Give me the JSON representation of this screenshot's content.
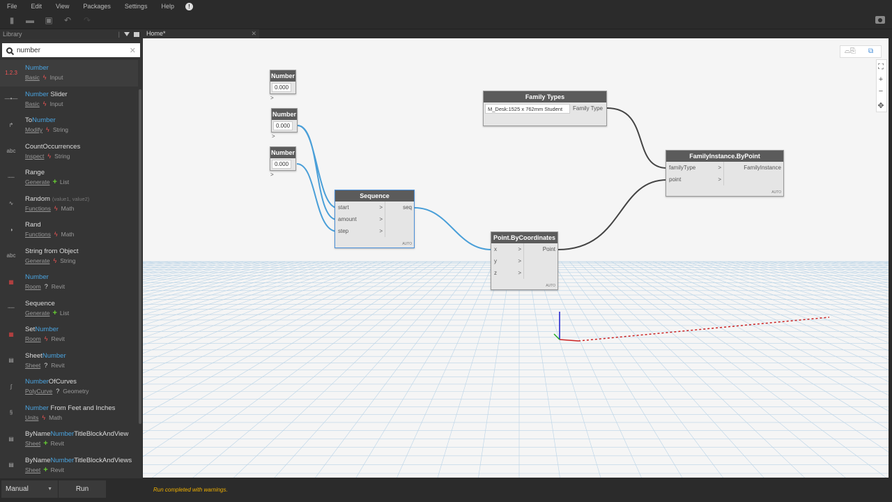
{
  "menu": [
    "File",
    "Edit",
    "View",
    "Packages",
    "Settings",
    "Help"
  ],
  "library": {
    "title": "Library",
    "search_value": "number",
    "items": [
      {
        "icon": "1.2.3",
        "pre": "",
        "hl": "Number",
        "post": "",
        "args": "",
        "cat": "Basic",
        "rel": "bolt",
        "grp": "Input",
        "sel": true
      },
      {
        "icon": "slider",
        "pre": "",
        "hl": "Number",
        "post": " Slider",
        "args": "",
        "cat": "Basic",
        "rel": "bolt",
        "grp": "Input"
      },
      {
        "icon": "to",
        "pre": "To",
        "hl": "Number",
        "post": "",
        "args": "",
        "cat": "Modify",
        "rel": "bolt",
        "grp": "String"
      },
      {
        "icon": "abc",
        "pre": "CountOccurrences",
        "hl": "",
        "post": "",
        "args": "",
        "cat": "Inspect",
        "rel": "bolt",
        "grp": "String"
      },
      {
        "icon": "range",
        "pre": "Range",
        "hl": "",
        "post": "",
        "args": "",
        "cat": "Generate",
        "rel": "plus",
        "grp": "List"
      },
      {
        "icon": "random",
        "pre": "Random",
        "hl": "",
        "post": "",
        "args": "(value1, value2)",
        "cat": "Functions",
        "rel": "bolt",
        "grp": "Math"
      },
      {
        "icon": "rand",
        "pre": "Rand",
        "hl": "",
        "post": "",
        "args": "",
        "cat": "Functions",
        "rel": "bolt",
        "grp": "Math"
      },
      {
        "icon": "abc",
        "pre": "String from Object",
        "hl": "",
        "post": "",
        "args": "",
        "cat": "Generate",
        "rel": "bolt",
        "grp": "String"
      },
      {
        "icon": "room",
        "pre": "",
        "hl": "Number",
        "post": "",
        "args": "",
        "cat": "Room",
        "rel": "q",
        "grp": "Revit"
      },
      {
        "icon": "seq",
        "pre": "Sequence",
        "hl": "",
        "post": "",
        "args": "",
        "cat": "Generate",
        "rel": "plus",
        "grp": "List"
      },
      {
        "icon": "room",
        "pre": "Set",
        "hl": "Number",
        "post": "",
        "args": "",
        "cat": "Room",
        "rel": "bolt",
        "grp": "Revit"
      },
      {
        "icon": "sheet",
        "pre": "Sheet",
        "hl": "Number",
        "post": "",
        "args": "",
        "cat": "Sheet",
        "rel": "q",
        "grp": "Revit"
      },
      {
        "icon": "curve",
        "pre": "",
        "hl": "Number",
        "post": "OfCurves",
        "args": "",
        "cat": "PolyCurve",
        "rel": "q",
        "grp": "Geometry"
      },
      {
        "icon": "units",
        "pre": "",
        "hl": "Number",
        "post": " From Feet and Inches",
        "args": "",
        "cat": "Units",
        "rel": "bolt",
        "grp": "Math"
      },
      {
        "icon": "sheet",
        "pre": "ByName",
        "hl": "Number",
        "post": "TitleBlockAndView",
        "args": "",
        "cat": "Sheet",
        "rel": "plus",
        "grp": "Revit"
      },
      {
        "icon": "sheet",
        "pre": "ByName",
        "hl": "Number",
        "post": "TitleBlockAndViews",
        "args": "",
        "cat": "Sheet",
        "rel": "plus",
        "grp": "Revit"
      }
    ]
  },
  "tab": {
    "label": "Home*"
  },
  "nodes": {
    "number1": {
      "title": "Number",
      "value": "0.000"
    },
    "number2": {
      "title": "Number",
      "value": "0.000"
    },
    "number3": {
      "title": "Number",
      "value": "0.000"
    },
    "sequence": {
      "title": "Sequence",
      "inputs": [
        "start",
        "amount",
        "step"
      ],
      "output": "seq",
      "lacing": "AUTO"
    },
    "point": {
      "title": "Point.ByCoordinates",
      "inputs": [
        "x",
        "y",
        "z"
      ],
      "output": "Point",
      "lacing": "AUTO"
    },
    "family_types": {
      "title": "Family Types",
      "selected": "M_Desk:1525 x 762mm Student",
      "output": "Family Type"
    },
    "family_instance": {
      "title": "FamilyInstance.ByPoint",
      "inputs": [
        "familyType",
        "point"
      ],
      "output": "FamilyInstance",
      "lacing": "AUTO"
    }
  },
  "bottom": {
    "run_mode": "Manual",
    "run_label": "Run",
    "status": "Run completed with warnings."
  },
  "colors": {
    "wire_selected": "#4a9fd8",
    "wire": "#444444",
    "highlight": "#4aa3df",
    "status": "#f0b000"
  }
}
